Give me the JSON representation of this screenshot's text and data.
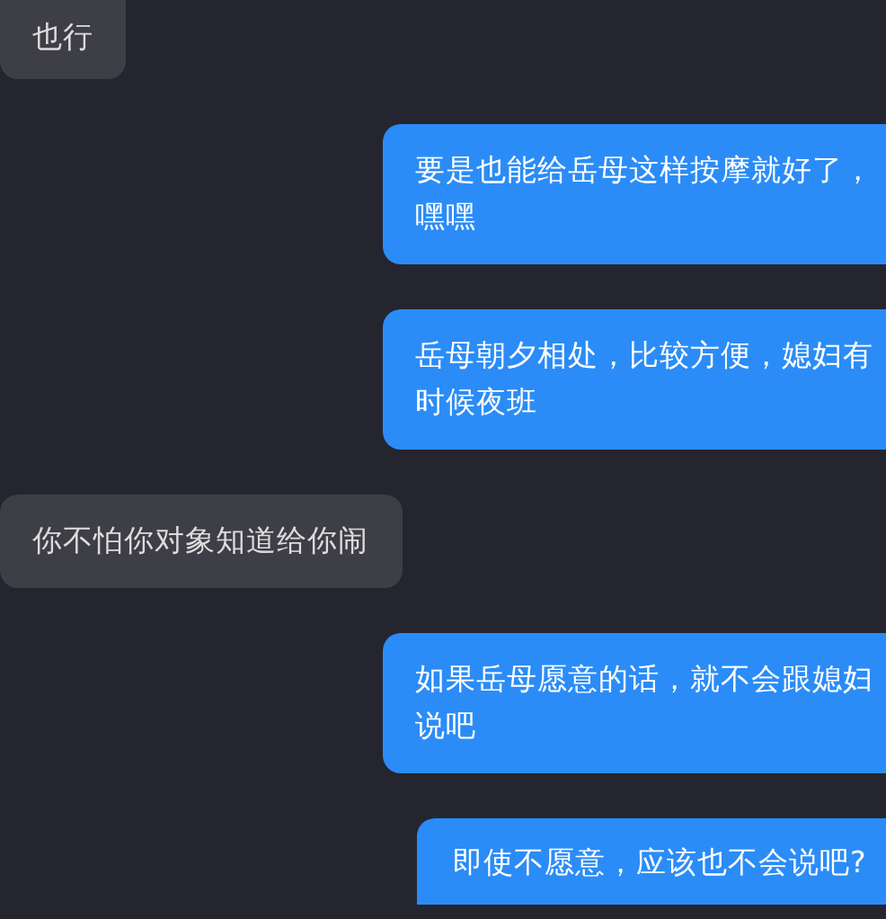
{
  "messages": [
    {
      "kind": "incoming",
      "lines": [
        "也行"
      ]
    },
    {
      "kind": "outgoing",
      "lines": [
        "要是也能给岳母这样按摩就好了，",
        "嘿嘿"
      ]
    },
    {
      "kind": "outgoing",
      "lines": [
        "岳母朝夕相处，比较方便，媳妇有",
        "时候夜班"
      ]
    },
    {
      "kind": "incoming",
      "lines": [
        "你不怕你对象知道给你闹"
      ]
    },
    {
      "kind": "outgoing",
      "lines": [
        "如果岳母愿意的话，就不会跟媳妇",
        "说吧"
      ]
    },
    {
      "kind": "outgoing",
      "lines": [
        "即使不愿意，应该也不会说吧?"
      ]
    }
  ]
}
